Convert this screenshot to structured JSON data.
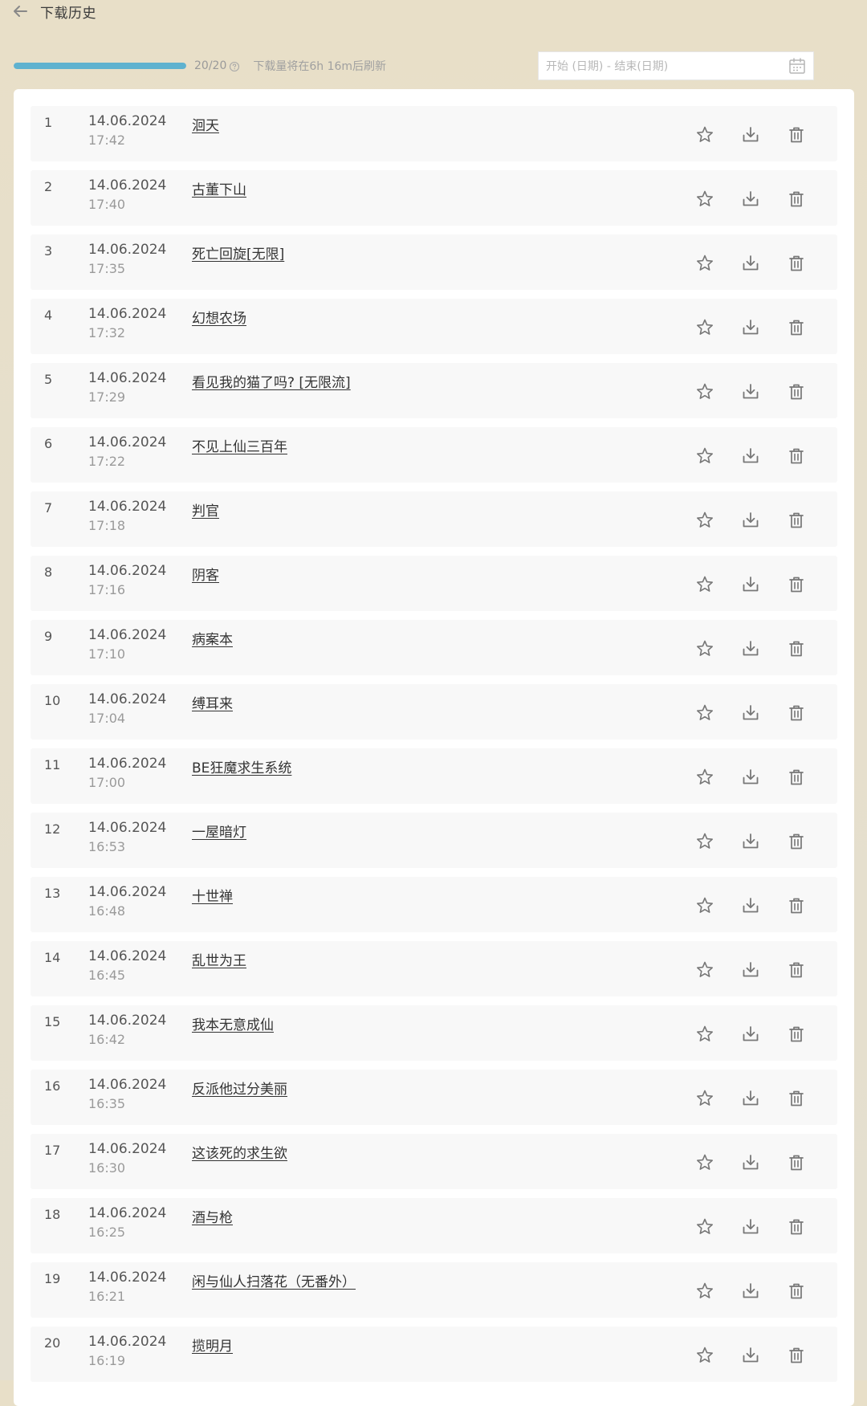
{
  "header": {
    "title": "下载历史",
    "back_icon": "arrow-left-icon"
  },
  "toolbar": {
    "quota_progress": 1.0,
    "quota_text": "20/20",
    "help_icon": "help-circle-icon",
    "refresh_note": "下载量将在6h 16m后刷新",
    "progress_color": "#5fb2cf"
  },
  "date_filter": {
    "placeholder": "开始 (日期) - 结束(日期)",
    "icon": "calendar-icon"
  },
  "row_actions": {
    "favorite_icon": "star-icon",
    "download_icon": "download-icon",
    "delete_icon": "trash-icon"
  },
  "downloads": [
    {
      "index": "1",
      "date": "14.06.2024",
      "time": "17:42",
      "title": "洄天"
    },
    {
      "index": "2",
      "date": "14.06.2024",
      "time": "17:40",
      "title": "古董下山"
    },
    {
      "index": "3",
      "date": "14.06.2024",
      "time": "17:35",
      "title": "死亡回旋[无限]"
    },
    {
      "index": "4",
      "date": "14.06.2024",
      "time": "17:32",
      "title": "幻想农场"
    },
    {
      "index": "5",
      "date": "14.06.2024",
      "time": "17:29",
      "title": "看见我的猫了吗? [无限流]"
    },
    {
      "index": "6",
      "date": "14.06.2024",
      "time": "17:22",
      "title": "不见上仙三百年"
    },
    {
      "index": "7",
      "date": "14.06.2024",
      "time": "17:18",
      "title": "判官"
    },
    {
      "index": "8",
      "date": "14.06.2024",
      "time": "17:16",
      "title": "阴客"
    },
    {
      "index": "9",
      "date": "14.06.2024",
      "time": "17:10",
      "title": "病案本"
    },
    {
      "index": "10",
      "date": "14.06.2024",
      "time": "17:04",
      "title": "缚耳来"
    },
    {
      "index": "11",
      "date": "14.06.2024",
      "time": "17:00",
      "title": "BE狂魔求生系统"
    },
    {
      "index": "12",
      "date": "14.06.2024",
      "time": "16:53",
      "title": "一屋暗灯"
    },
    {
      "index": "13",
      "date": "14.06.2024",
      "time": "16:48",
      "title": "十世禅"
    },
    {
      "index": "14",
      "date": "14.06.2024",
      "time": "16:45",
      "title": "乱世为王"
    },
    {
      "index": "15",
      "date": "14.06.2024",
      "time": "16:42",
      "title": "我本无意成仙"
    },
    {
      "index": "16",
      "date": "14.06.2024",
      "time": "16:35",
      "title": "反派他过分美丽"
    },
    {
      "index": "17",
      "date": "14.06.2024",
      "time": "16:30",
      "title": "这该死的求生欲"
    },
    {
      "index": "18",
      "date": "14.06.2024",
      "time": "16:25",
      "title": "酒与枪"
    },
    {
      "index": "19",
      "date": "14.06.2024",
      "time": "16:21",
      "title": "闲与仙人扫落花（无番外）"
    },
    {
      "index": "20",
      "date": "14.06.2024",
      "time": "16:19",
      "title": "揽明月"
    }
  ]
}
